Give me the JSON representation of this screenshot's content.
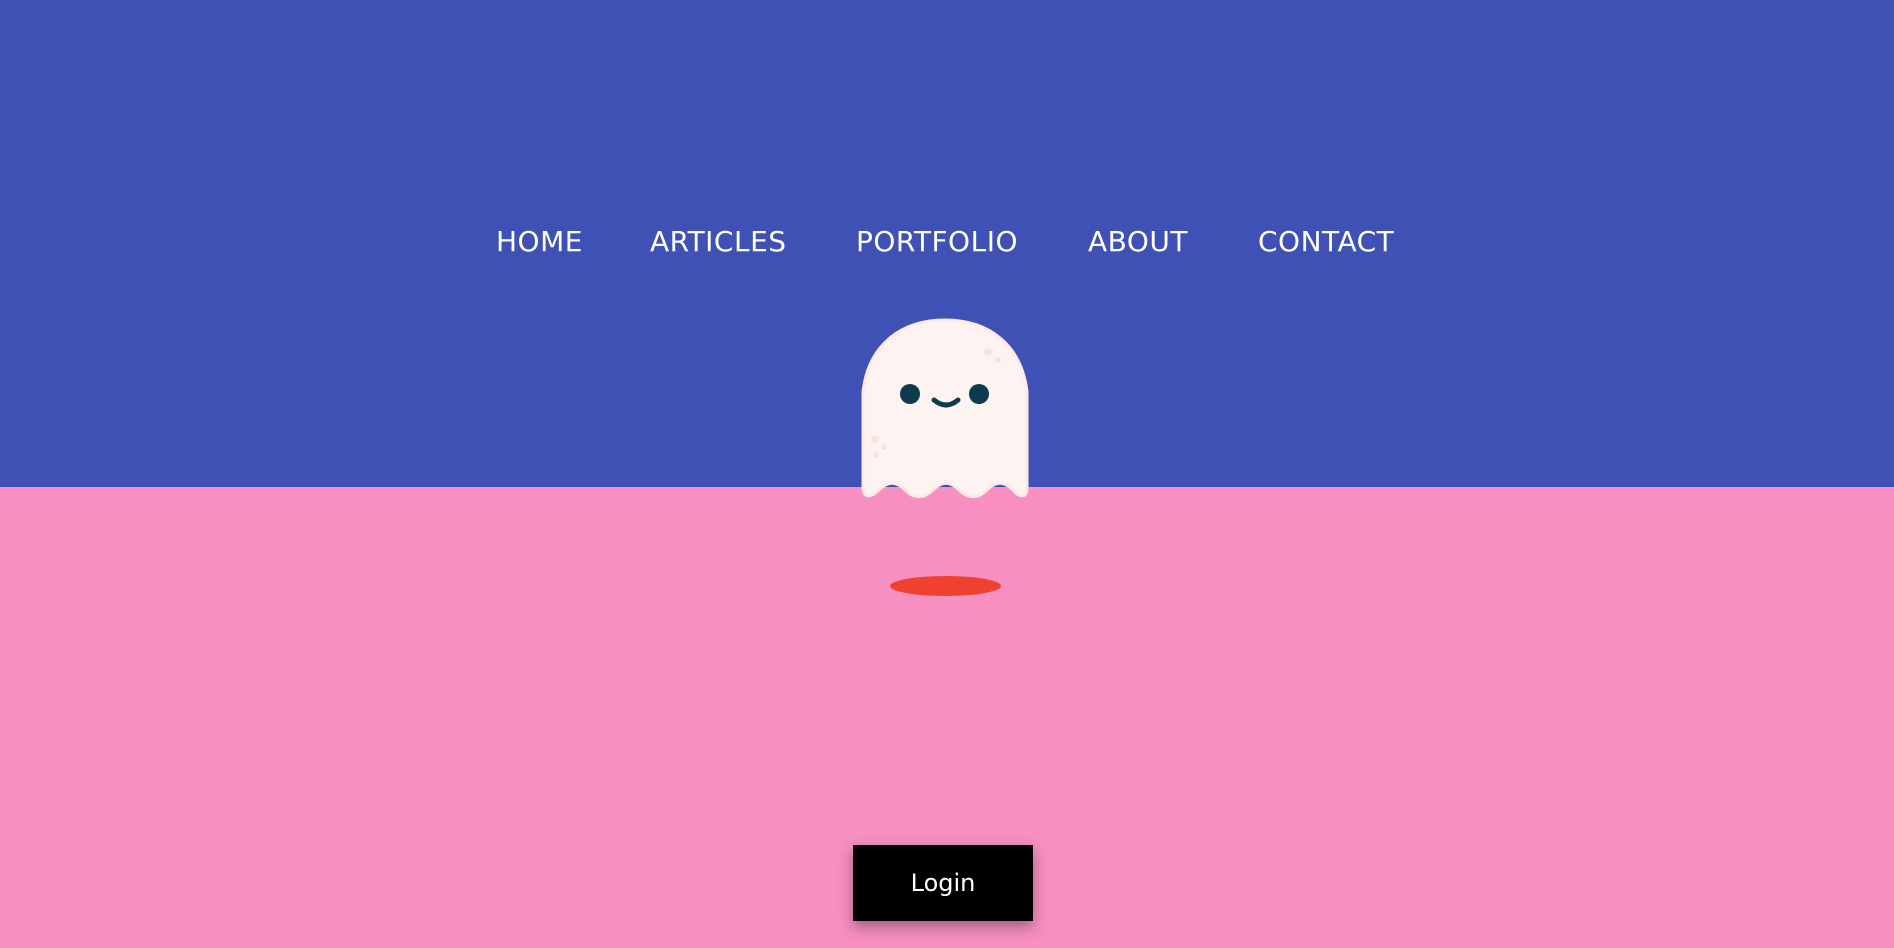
{
  "nav": {
    "items": [
      {
        "label": "HOME"
      },
      {
        "label": "ARTICLES"
      },
      {
        "label": "PORTFOLIO"
      },
      {
        "label": "ABOUT"
      },
      {
        "label": "CONTACT"
      }
    ]
  },
  "mascot": {
    "icon": "ghost-icon"
  },
  "login": {
    "label": "Login"
  },
  "colors": {
    "top_band": "#3f51b5",
    "bottom_band": "#f78fc1",
    "ghost_body": "#fdf3f1",
    "ghost_eyes": "#0d3b4c",
    "shadow": "#ef4130",
    "button_bg": "#000000",
    "button_text": "#ffffff",
    "nav_text": "#ffffff"
  }
}
